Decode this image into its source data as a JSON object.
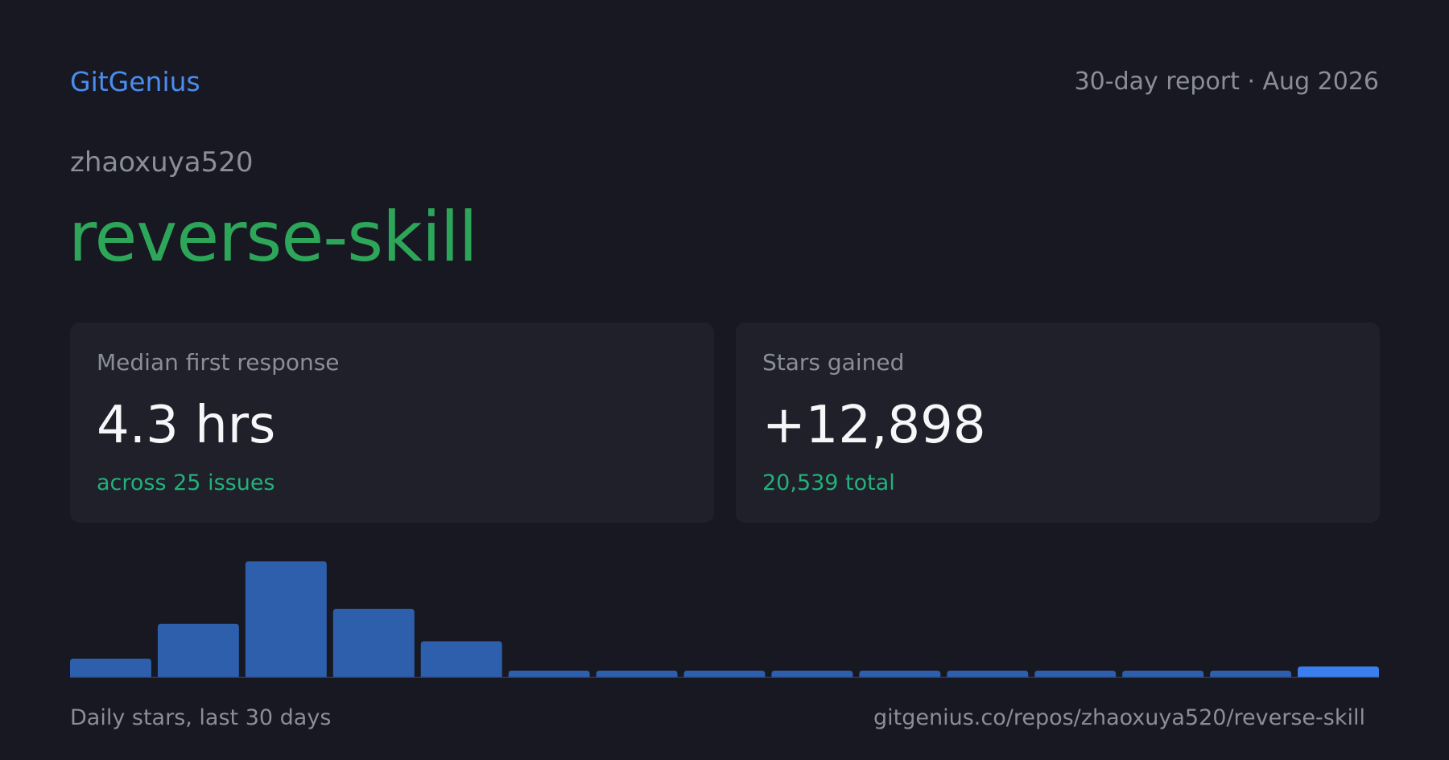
{
  "header": {
    "brand": "GitGenius",
    "report_label": "30-day report · Aug 2026"
  },
  "repo": {
    "owner": "zhaoxuya520",
    "name": "reverse-skill"
  },
  "cards": {
    "response": {
      "label": "Median first response",
      "value": "4.3 hrs",
      "sub": "across 25 issues"
    },
    "stars": {
      "label": "Stars gained",
      "value": "+12,898",
      "sub": "20,539 total"
    }
  },
  "footer": {
    "caption": "Daily stars, last 30 days",
    "url": "gitgenius.co/repos/zhaoxuya520/reverse-skill"
  },
  "colors": {
    "brand": "#4a8df0",
    "repo_name": "#2ea65a",
    "sub_text": "#23b07a",
    "bar": "#2d5fad",
    "bar_latest": "#3b7ef0",
    "background": "#171821",
    "card": "#1f2029"
  },
  "chart_data": {
    "type": "bar",
    "title": "",
    "xlabel": "",
    "ylabel": "",
    "values": [
      1600,
      4600,
      10000,
      5900,
      3100,
      560,
      560,
      560,
      560,
      560,
      560,
      560,
      560,
      560,
      930
    ],
    "ylim": [
      0,
      10000
    ],
    "grid": false,
    "highlight_last": true
  }
}
